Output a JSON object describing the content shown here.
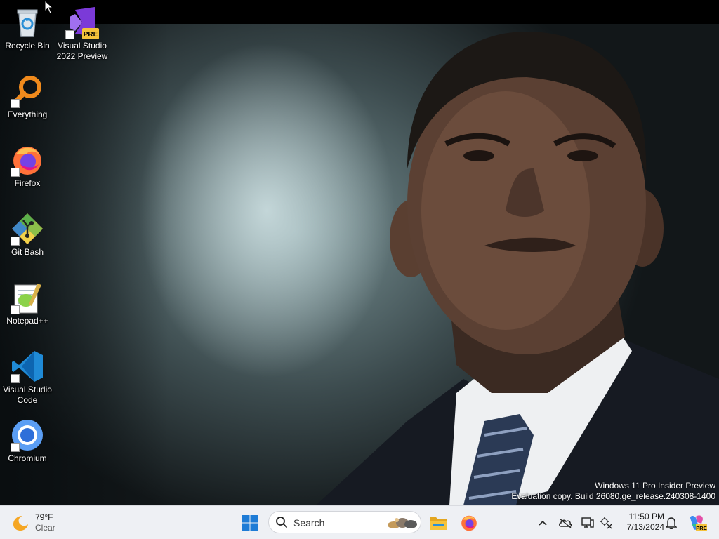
{
  "desktop": {
    "icons": [
      {
        "label": "Recycle Bin"
      },
      {
        "label": "Visual Studio 2022 Preview",
        "line1": "Visual Studio",
        "line2": "2022 Preview",
        "badge": "PRE"
      },
      {
        "label": "Everything"
      },
      {
        "label": "Firefox"
      },
      {
        "label": "Git Bash"
      },
      {
        "label": "Notepad++"
      },
      {
        "label": "Visual Studio Code",
        "line1": "Visual Studio",
        "line2": "Code"
      },
      {
        "label": "Chromium"
      }
    ]
  },
  "watermark": {
    "line1": "Windows 11 Pro Insider Preview",
    "line2": "Evaluation copy. Build 26080.ge_release.240308-1400"
  },
  "taskbar": {
    "weather": {
      "temp": "79°F",
      "condition": "Clear",
      "icon": "moon-icon"
    },
    "search": {
      "label": "Search"
    },
    "pinned": [
      "start-icon",
      "file-explorer-icon",
      "firefox-icon"
    ],
    "tray_icons": [
      "chevron-up-icon",
      "onedrive-offline-icon",
      "display-icon",
      "network-icon",
      "notification-bell-icon",
      "copilot-icon"
    ],
    "copilot_badge": "PRE",
    "clock": {
      "time": "11:50 PM",
      "date": "7/13/2024"
    }
  },
  "colors": {
    "taskbar_bg": "#eef0f4",
    "windows_blue": "#1e7cd6",
    "folder_yellow": "#f5c33b"
  }
}
